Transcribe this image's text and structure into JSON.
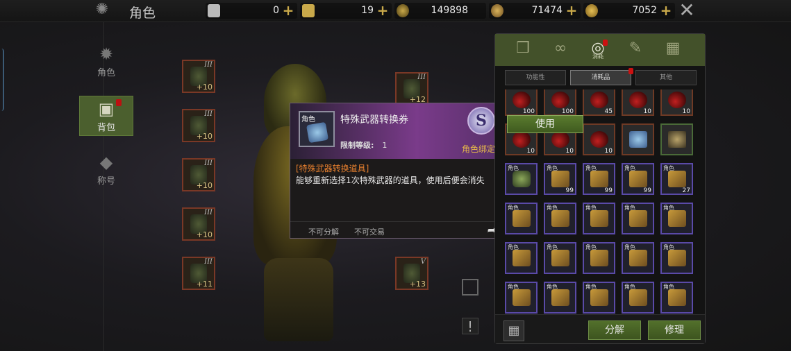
{
  "header": {
    "title": "角色",
    "currencies": [
      {
        "icon": "card-ticket-icon",
        "value": "0"
      },
      {
        "icon": "gold-ticket-icon",
        "value": "19"
      },
      {
        "icon": "ring-coin-icon",
        "value": "149898"
      },
      {
        "icon": "gold-bag-icon",
        "value": "71474"
      },
      {
        "icon": "gold-coin-icon",
        "value": "7052"
      }
    ]
  },
  "sidebar": {
    "items": [
      {
        "label": "角色",
        "icon": "character-icon"
      },
      {
        "label": "背包",
        "icon": "backpack-icon"
      },
      {
        "label": "称号",
        "icon": "title-icon"
      }
    ]
  },
  "equipment": {
    "left": [
      {
        "tier": "III",
        "level": "+10"
      },
      {
        "tier": "III",
        "level": "+10"
      },
      {
        "tier": "III",
        "level": "+10"
      },
      {
        "tier": "III",
        "level": "+10"
      },
      {
        "tier": "III",
        "level": "+11"
      }
    ],
    "right": [
      {
        "tier": "III",
        "level": "+12"
      },
      {
        "tier": "V",
        "level": "+13"
      }
    ]
  },
  "tooltip": {
    "icon_tag": "角色",
    "title": "特殊武器转换券",
    "req_label": "限制等级:",
    "req_value": "1",
    "grade": "S",
    "binding": "角色绑定",
    "subtitle": "[特殊武器转换道具]",
    "description": "能够重新选择1次特殊武器的道具，使用后便会消失",
    "flag1": "不可分解",
    "flag2": "不可交易"
  },
  "inventory": {
    "tabs": [
      {
        "icon": "equipment-box-icon"
      },
      {
        "icon": "link-icon"
      },
      {
        "icon": "consumable-icon",
        "label": "消耗"
      },
      {
        "icon": "brush-icon"
      },
      {
        "icon": "card-icon"
      }
    ],
    "subtabs": [
      "功能性",
      "消耗品",
      "其他"
    ],
    "use_button": "使用",
    "rows": [
      [
        {
          "g": "potion",
          "c": "100"
        },
        {
          "g": "potion",
          "c": "100"
        },
        {
          "g": "potion",
          "c": "45"
        },
        {
          "g": "potion",
          "c": "10"
        },
        {
          "g": "potion",
          "c": "10"
        }
      ],
      [
        {
          "g": "potion",
          "c": "10"
        },
        {
          "g": "potion",
          "c": "10"
        },
        {
          "g": "potion",
          "c": "10"
        },
        {
          "g": "scroll",
          "c": ""
        },
        {
          "g": "chest",
          "c": ""
        }
      ],
      [
        {
          "g": "jar",
          "c": "",
          "tag": "角色"
        },
        {
          "g": "box",
          "c": "99",
          "tag": "角色"
        },
        {
          "g": "box",
          "c": "99",
          "tag": "角色"
        },
        {
          "g": "box",
          "c": "99",
          "tag": "角色"
        },
        {
          "g": "box",
          "c": "27",
          "tag": "角色"
        }
      ],
      [
        {
          "g": "box",
          "c": "",
          "tag": "角色"
        },
        {
          "g": "box",
          "c": "",
          "tag": "角色"
        },
        {
          "g": "box",
          "c": "",
          "tag": "角色"
        },
        {
          "g": "box",
          "c": "",
          "tag": "角色"
        },
        {
          "g": "box",
          "c": "",
          "tag": "角色"
        }
      ],
      [
        {
          "g": "box",
          "c": "",
          "tag": "角色"
        },
        {
          "g": "box",
          "c": "",
          "tag": "角色"
        },
        {
          "g": "box",
          "c": "",
          "tag": "角色"
        },
        {
          "g": "box",
          "c": "",
          "tag": "角色"
        },
        {
          "g": "box",
          "c": "",
          "tag": "角色"
        }
      ],
      [
        {
          "g": "box",
          "c": "",
          "tag": "角色"
        },
        {
          "g": "box",
          "c": "",
          "tag": "角色"
        },
        {
          "g": "box",
          "c": "",
          "tag": "角色"
        },
        {
          "g": "box",
          "c": "",
          "tag": "角色"
        },
        {
          "g": "box",
          "c": "",
          "tag": "角色"
        }
      ]
    ],
    "decompose": "分解",
    "repair": "修理"
  }
}
